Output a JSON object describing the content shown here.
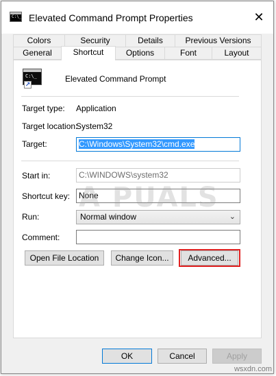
{
  "window": {
    "title": "Elevated Command Prompt Properties",
    "close_glyph": "✕",
    "icon": "cmd-icon"
  },
  "tabs_row1": [
    "Colors",
    "Security",
    "Details",
    "Previous Versions"
  ],
  "tabs_row2": [
    "General",
    "Shortcut",
    "Options",
    "Font",
    "Layout"
  ],
  "active_tab": "Shortcut",
  "shortcut": {
    "name": "Elevated Command Prompt",
    "icon_prompt": "C:\\_",
    "target_type_label": "Target type:",
    "target_type_value": "Application",
    "target_location_label": "Target location:",
    "target_location_value": "System32",
    "target_label": "Target:",
    "target_value": "C:\\Windows\\System32\\cmd.exe",
    "start_in_label": "Start in:",
    "start_in_value": "C:\\WINDOWS\\system32",
    "shortcut_key_label": "Shortcut key:",
    "shortcut_key_value": "None",
    "run_label": "Run:",
    "run_value": "Normal window",
    "comment_label": "Comment:",
    "comment_value": "",
    "open_file_location_button": "Open File Location",
    "change_icon_button": "Change Icon...",
    "advanced_button": "Advanced..."
  },
  "footer": {
    "ok": "OK",
    "cancel": "Cancel",
    "apply": "Apply"
  },
  "watermark": "A PUALS",
  "site_label": "wsxdn.com",
  "colors": {
    "highlight": "#e02020",
    "selection": "#3399ff",
    "focus_border": "#0078d7"
  }
}
